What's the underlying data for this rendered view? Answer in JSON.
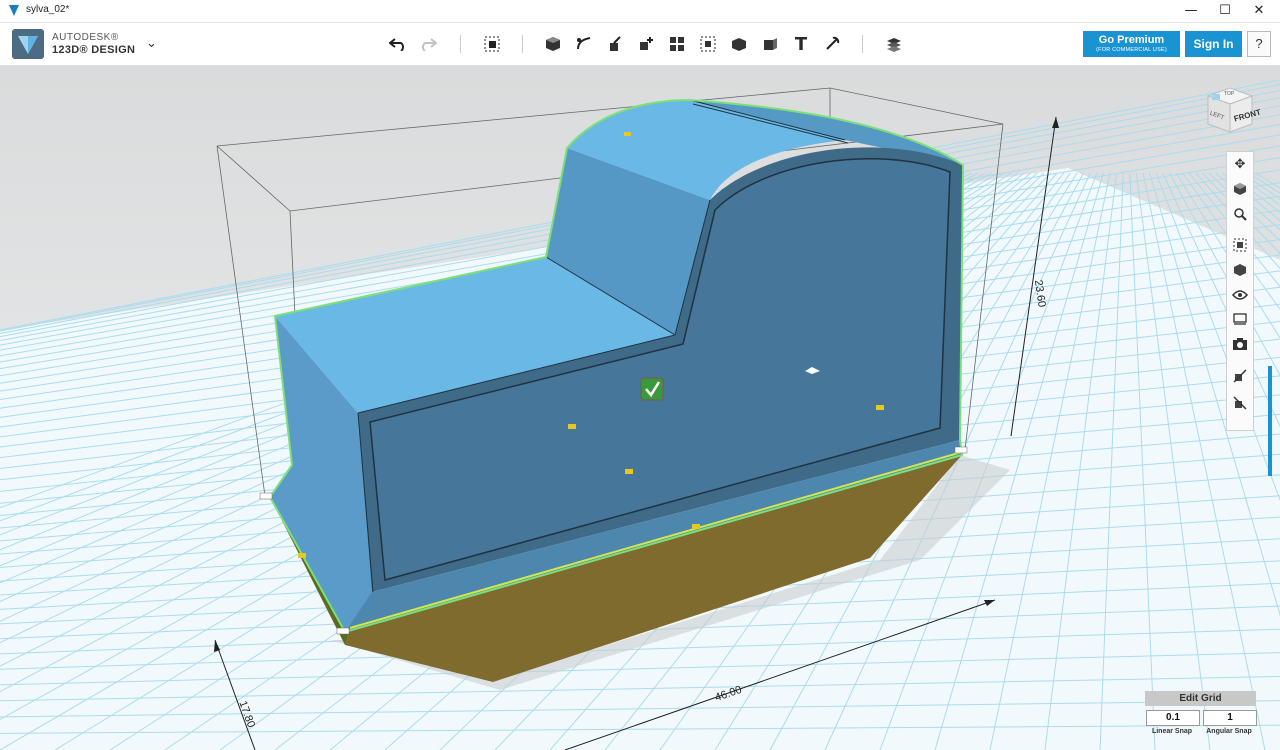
{
  "window": {
    "title": "sylva_02*",
    "minimize_glyph": "—",
    "maximize_glyph": "☐",
    "close_glyph": "✕"
  },
  "app": {
    "brand_line1": "AUTODESK®",
    "brand_line2": "123D® DESIGN",
    "menu_glyph": "⌄"
  },
  "toolbar": {
    "undo_icon": "undo-icon",
    "redo_icon": "redo-icon",
    "tools": [
      "transform-icon",
      "primitives-icon",
      "sketch-icon",
      "construct-icon",
      "modify-icon",
      "pattern-icon",
      "grouping-icon",
      "combine-icon",
      "measure-icon",
      "text-icon",
      "snap-icon",
      "material-icon"
    ],
    "text_tool_glyph": "T"
  },
  "account": {
    "premium_label": "Go Premium",
    "premium_sublabel": "(FOR COMMERCIAL USE)",
    "signin_label": "Sign In",
    "help_label": "?"
  },
  "viewcube": {
    "front_label": "FRONT",
    "left_label": "LEFT",
    "top_label": "TOP"
  },
  "dimensions": {
    "height": "23.60",
    "length": "46.00",
    "depth": "17.80"
  },
  "navbar": {
    "items": [
      "pan-icon",
      "orbit-icon",
      "zoom-icon",
      "fit-icon",
      "view-icon",
      "visibility-icon",
      "materials-outline-icon",
      "camera-icon",
      "snap-grid-icon",
      "hide-icon"
    ]
  },
  "grid": {
    "edit_label": "Edit Grid",
    "linear_value": "0.1",
    "angular_value": "1",
    "linear_label": "Linear Snap",
    "angular_label": "Angular Snap"
  },
  "colors": {
    "accent": "#1993d1",
    "part_top": "#6ab8e6",
    "part_side": "#3f6b89",
    "part_front": "#4a82a8",
    "base": "#7f6b2d",
    "selection": "#7ce07a",
    "grid_line": "#a9dcef",
    "viewport_bg": "#e3e5e6"
  }
}
